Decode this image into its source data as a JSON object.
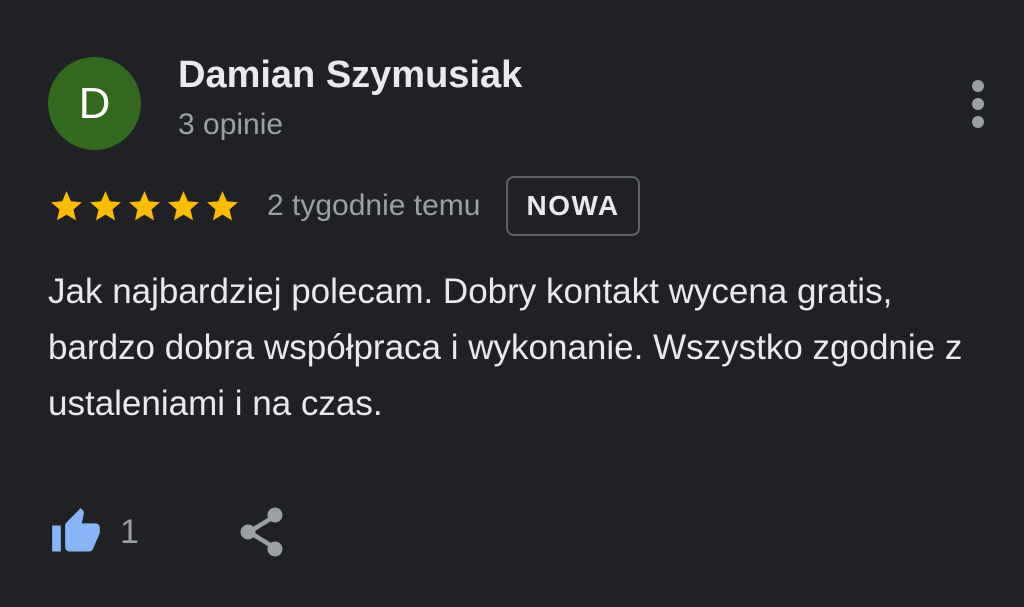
{
  "review": {
    "author": {
      "initial": "D",
      "name": "Damian Szymusiak",
      "meta": "3 opinie",
      "avatar_color": "#33691e"
    },
    "rating": 5,
    "max_rating": 5,
    "star_color": "#fbbc04",
    "date": "2 tygodnie temu",
    "badge": "NOWA",
    "text": "Jak najbardziej polecam. Dobry kontakt wycena gratis, bardzo dobra współpraca i wykonanie. Wszystko zgodnie z ustaleniami i na czas.",
    "likes": "1",
    "like_color": "#8ab4f8",
    "icons": {
      "more": "more-vert-icon",
      "like": "thumbs-up-icon",
      "share": "share-icon"
    }
  }
}
